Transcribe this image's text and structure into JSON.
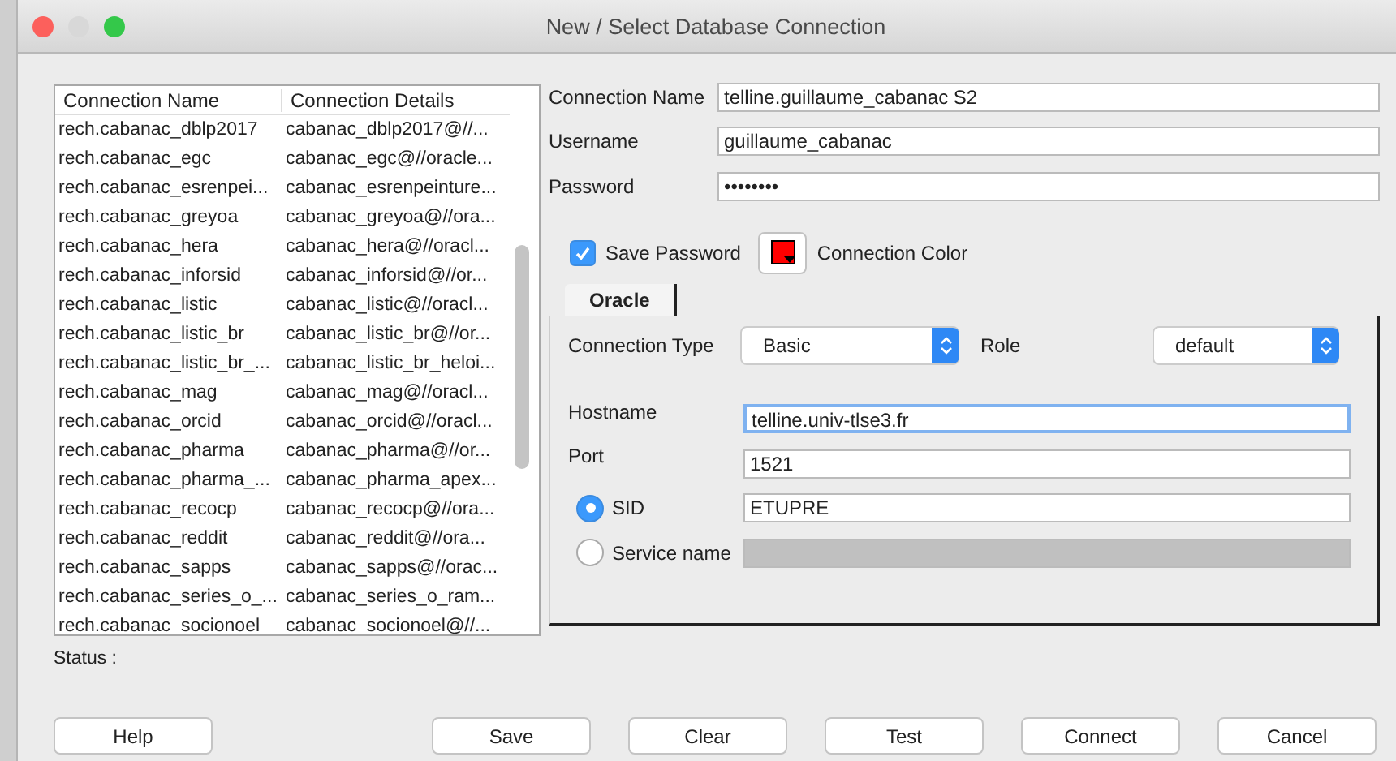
{
  "window": {
    "title": "New / Select Database Connection"
  },
  "connections": {
    "columns": [
      "Connection Name",
      "Connection Details"
    ],
    "rows": [
      {
        "name": "rech.cabanac_dblp2017",
        "details": "cabanac_dblp2017@//..."
      },
      {
        "name": "rech.cabanac_egc",
        "details": "cabanac_egc@//oracle..."
      },
      {
        "name": "rech.cabanac_esrenpei...",
        "details": "cabanac_esrenpeinture..."
      },
      {
        "name": "rech.cabanac_greyoa",
        "details": "cabanac_greyoa@//ora..."
      },
      {
        "name": "rech.cabanac_hera",
        "details": "cabanac_hera@//oracl..."
      },
      {
        "name": "rech.cabanac_inforsid",
        "details": "cabanac_inforsid@//or..."
      },
      {
        "name": "rech.cabanac_listic",
        "details": "cabanac_listic@//oracl..."
      },
      {
        "name": "rech.cabanac_listic_br",
        "details": "cabanac_listic_br@//or..."
      },
      {
        "name": "rech.cabanac_listic_br_...",
        "details": "cabanac_listic_br_heloi..."
      },
      {
        "name": "rech.cabanac_mag",
        "details": "cabanac_mag@//oracl..."
      },
      {
        "name": "rech.cabanac_orcid",
        "details": "cabanac_orcid@//oracl..."
      },
      {
        "name": "rech.cabanac_pharma",
        "details": "cabanac_pharma@//or..."
      },
      {
        "name": "rech.cabanac_pharma_...",
        "details": "cabanac_pharma_apex..."
      },
      {
        "name": "rech.cabanac_recocp",
        "details": "cabanac_recocp@//ora..."
      },
      {
        "name": "rech.cabanac_reddit",
        "details": "cabanac_reddit@//ora..."
      },
      {
        "name": "rech.cabanac_sapps",
        "details": "cabanac_sapps@//orac..."
      },
      {
        "name": "rech.cabanac_series_o_...",
        "details": "cabanac_series_o_ram..."
      },
      {
        "name": "rech.cabanac_socionoel",
        "details": "cabanac_socionoel@//..."
      }
    ]
  },
  "form": {
    "fields": [
      {
        "label": "Connection Name",
        "value": "telline.guillaume_cabanac S2"
      },
      {
        "label": "Username",
        "value": "guillaume_cabanac"
      },
      {
        "label": "Password",
        "value": "••••••••"
      }
    ],
    "save_password": {
      "label": "Save Password",
      "checked": true
    },
    "connection_color": {
      "label": "Connection Color",
      "color": "#ff0000"
    }
  },
  "tabs": [
    {
      "label": "Oracle",
      "selected": true
    }
  ],
  "oracle": {
    "connection_type": {
      "label": "Connection Type",
      "value": "Basic"
    },
    "role": {
      "label": "Role",
      "value": "default"
    },
    "fields": [
      {
        "label": "Hostname",
        "value": "telline.univ-tlse3.fr",
        "focused": true
      },
      {
        "label": "Port",
        "value": "1521",
        "focused": false
      }
    ],
    "identifiers": [
      {
        "label": "SID",
        "selected": true,
        "value": "ETUPRE"
      },
      {
        "label": "Service name",
        "selected": false
      }
    ]
  },
  "status": {
    "label": "Status :"
  },
  "help_button": {
    "label": "Help"
  },
  "buttons": [
    {
      "label": "Save"
    },
    {
      "label": "Clear"
    },
    {
      "label": "Test"
    },
    {
      "label": "Connect"
    },
    {
      "label": "Cancel"
    }
  ]
}
